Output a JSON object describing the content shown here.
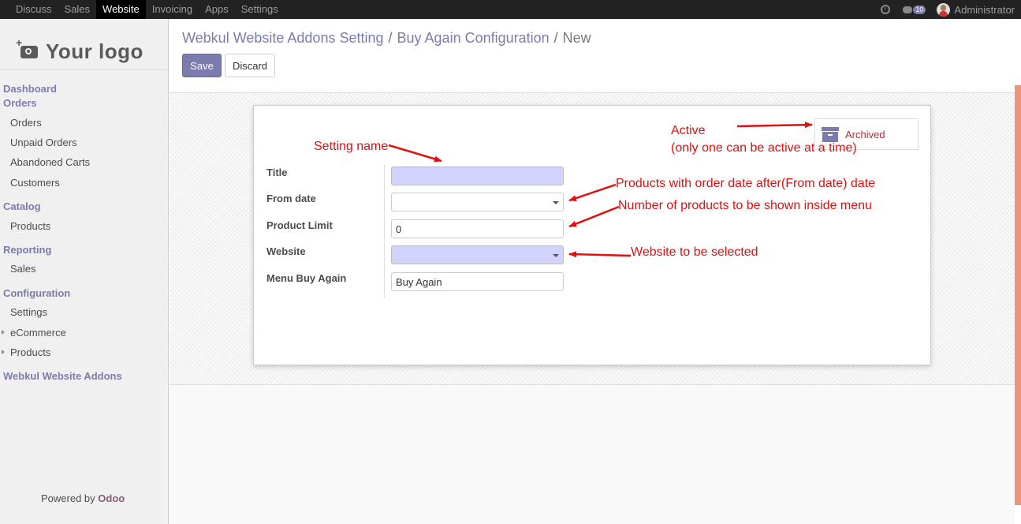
{
  "topbar": {
    "menu": [
      "Discuss",
      "Sales",
      "Website",
      "Invoicing",
      "Apps",
      "Settings"
    ],
    "active_menu": "Website",
    "chat_count": "10",
    "user": "Administrator"
  },
  "sidebar": {
    "logo_text": "Your logo",
    "sections": [
      {
        "label": "Dashboard",
        "items": []
      },
      {
        "label": "Orders",
        "items": [
          "Orders",
          "Unpaid Orders",
          "Abandoned Carts",
          "Customers"
        ]
      },
      {
        "label": "Catalog",
        "items": [
          "Products"
        ]
      },
      {
        "label": "Reporting",
        "items": [
          "Sales"
        ]
      },
      {
        "label": "Configuration",
        "items": [
          "Settings",
          "eCommerce",
          "Products"
        ]
      },
      {
        "label": "Webkul Website Addons",
        "items": []
      }
    ],
    "powered_by": "Powered by",
    "powered_brand": "Odoo"
  },
  "breadcrumb": {
    "items": [
      "Webkul Website Addons Setting",
      "Buy Again Configuration"
    ],
    "separator": "/",
    "current": "New"
  },
  "buttons": {
    "save": "Save",
    "discard": "Discard"
  },
  "form": {
    "archived_label": "Archived",
    "fields": [
      {
        "label": "Title",
        "value": "",
        "type": "text",
        "required": true
      },
      {
        "label": "From date",
        "value": "",
        "type": "select",
        "required": false
      },
      {
        "label": "Product Limit",
        "value": "0",
        "type": "text",
        "required": false
      },
      {
        "label": "Website",
        "value": "",
        "type": "select",
        "required": true
      },
      {
        "label": "Menu Buy Again",
        "value": "Buy Again",
        "type": "text",
        "required": false
      }
    ]
  },
  "annotations": {
    "setting_name": "Setting name",
    "active": "Active",
    "active_note": "(only one can be active at a time)",
    "from_date": "Products with order date after(From date) date",
    "product_limit": "Number of products to be shown inside menu",
    "website": "Website to be selected"
  },
  "colors": {
    "accent": "#7c7bad",
    "topbar": "#222222",
    "annotation": "#e01010",
    "required_field": "#d2d2ff"
  }
}
